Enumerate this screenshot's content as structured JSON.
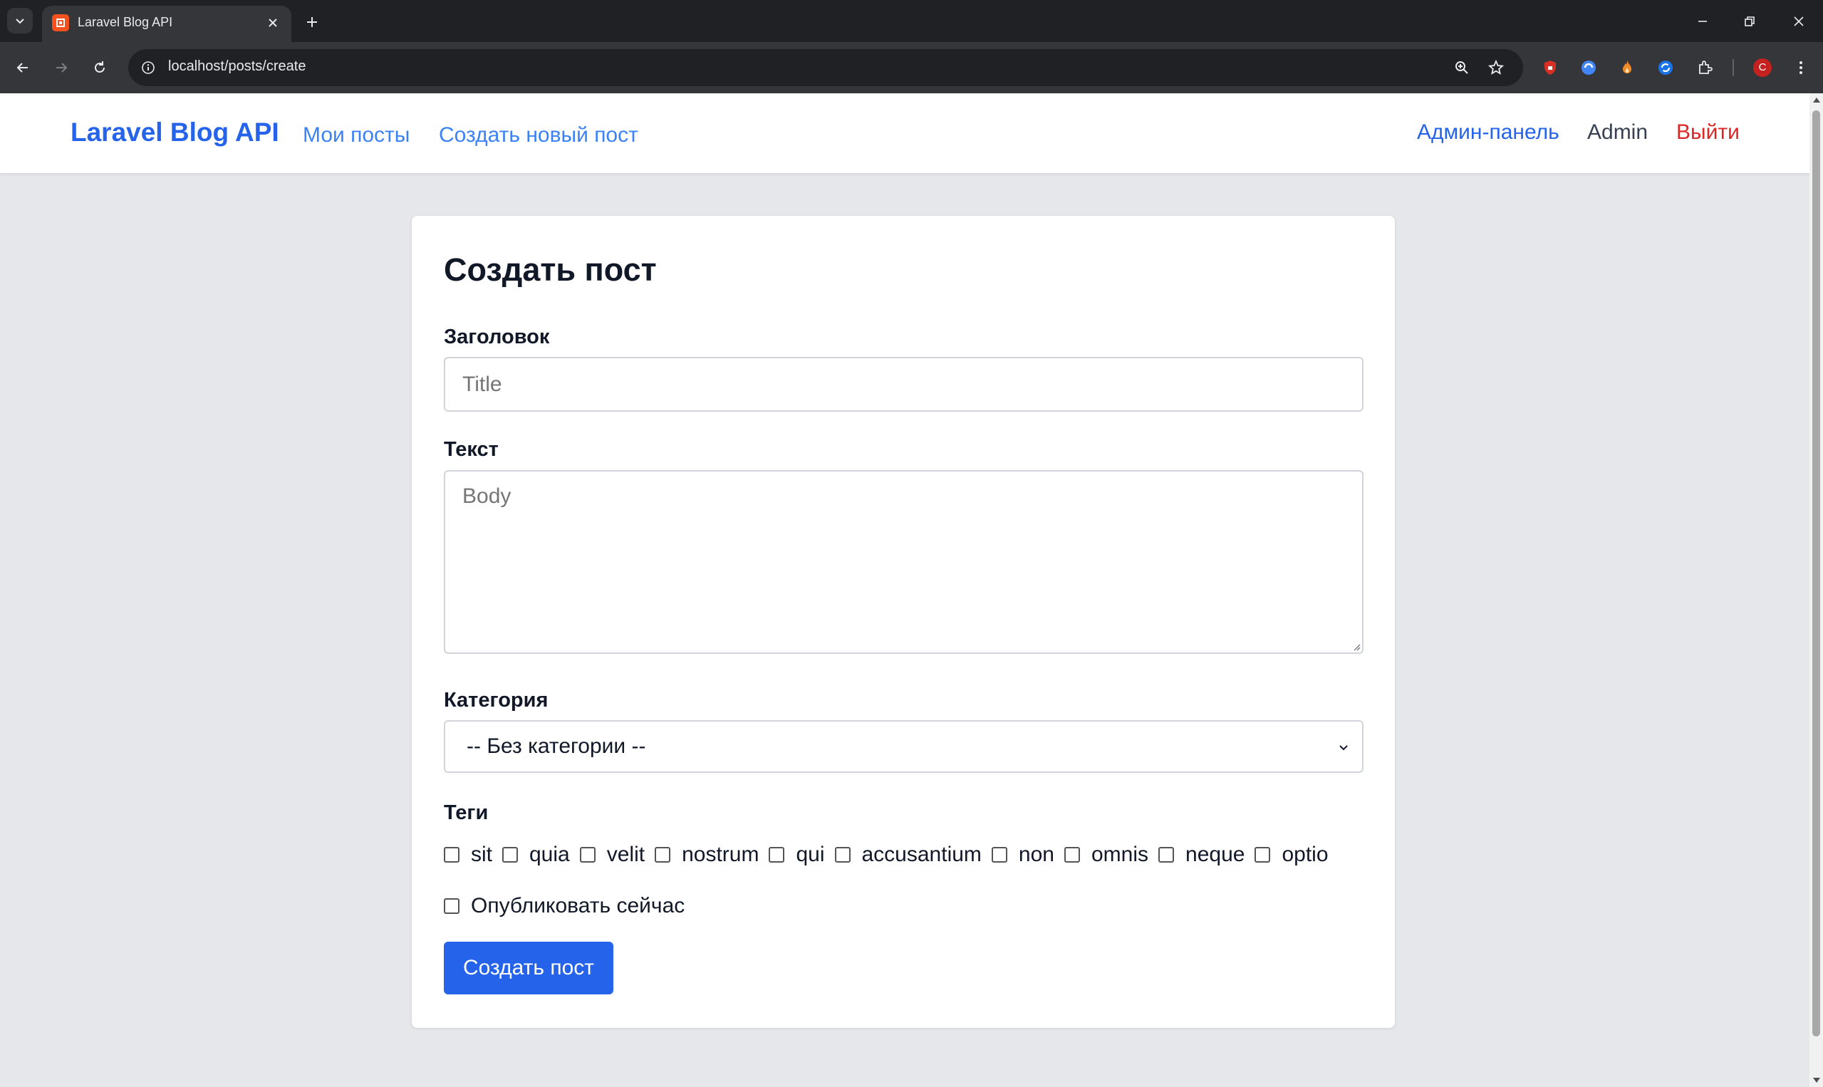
{
  "browser": {
    "tab_title": "Laravel Blog API",
    "url_host": "localhost",
    "url_path": "/posts/create",
    "profile_initial": "C"
  },
  "nav": {
    "brand": "Laravel Blog API",
    "links": [
      "Мои посты",
      "Создать новый пост"
    ],
    "admin_panel": "Админ-панель",
    "user_name": "Admin",
    "logout": "Выйти"
  },
  "form": {
    "title": "Создать пост",
    "title_label": "Заголовок",
    "title_placeholder": "Title",
    "body_label": "Текст",
    "body_placeholder": "Body",
    "category_label": "Категория",
    "category_selected": "-- Без категории --",
    "tags_label": "Теги",
    "tags": [
      "sit",
      "quia",
      "velit",
      "nostrum",
      "qui",
      "accusantium",
      "non",
      "omnis",
      "neque",
      "optio"
    ],
    "publish_label": "Опубликовать сейчас",
    "submit_label": "Создать пост"
  },
  "colors": {
    "brand": "#2563eb",
    "link": "#3b82f6",
    "logout": "#dc2626",
    "page_bg": "#e5e7eb"
  }
}
